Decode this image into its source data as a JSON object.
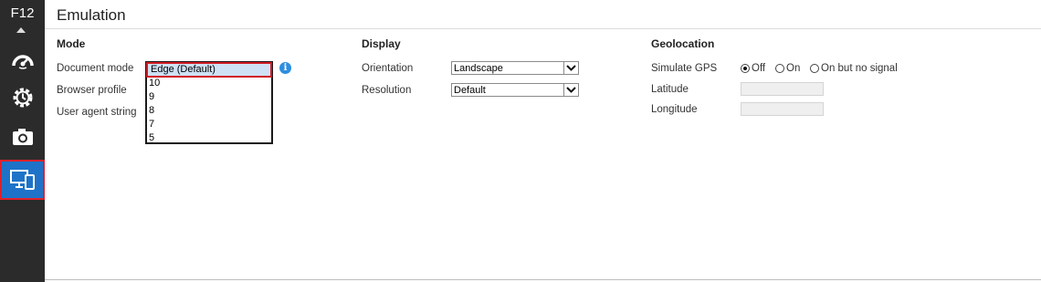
{
  "sidebar": {
    "label": "F12",
    "items": [
      {
        "icon": "performance-gauge-icon"
      },
      {
        "icon": "timer-settings-icon"
      },
      {
        "icon": "camera-icon"
      },
      {
        "icon": "emulation-devices-icon",
        "active": true
      }
    ]
  },
  "page": {
    "title": "Emulation"
  },
  "mode": {
    "heading": "Mode",
    "document_mode_label": "Document mode",
    "browser_profile_label": "Browser profile",
    "user_agent_label": "User agent string",
    "document_mode_options": [
      "Edge (Default)",
      "10",
      "9",
      "8",
      "7",
      "5"
    ],
    "document_mode_selected": "Edge (Default)"
  },
  "display": {
    "heading": "Display",
    "orientation_label": "Orientation",
    "orientation_value": "Landscape",
    "resolution_label": "Resolution",
    "resolution_value": "Default"
  },
  "geolocation": {
    "heading": "Geolocation",
    "simulate_gps_label": "Simulate GPS",
    "options": [
      "Off",
      "On",
      "On but no signal"
    ],
    "selected": "Off",
    "latitude_label": "Latitude",
    "latitude_value": "",
    "longitude_label": "Longitude",
    "longitude_value": ""
  },
  "colors": {
    "sidebar_bg": "#2b2b2b",
    "active_tab": "#1e73c8",
    "highlight_outline": "#d01c24",
    "info_icon": "#2d8ee0"
  }
}
